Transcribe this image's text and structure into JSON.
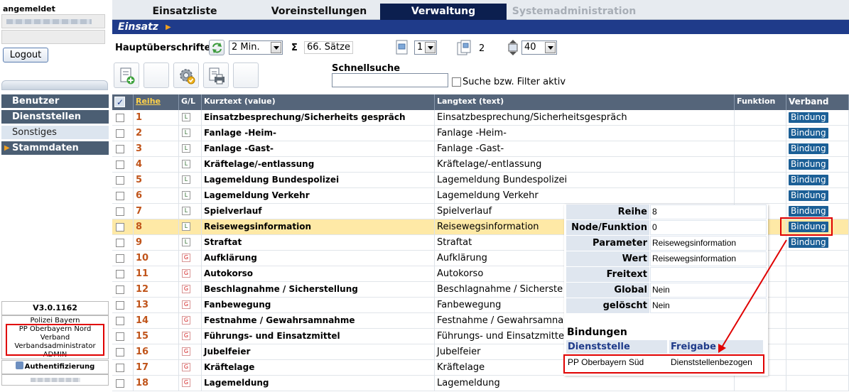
{
  "sidebar": {
    "login_label": "angemeldet",
    "logout_label": "Logout",
    "nav": [
      {
        "label": "Benutzer"
      },
      {
        "label": "Dienststellen"
      },
      {
        "label": "Sonstiges"
      },
      {
        "label": "Stammdaten"
      }
    ],
    "version": "V3.0.1162",
    "org_lines": [
      "Polizei Bayern",
      "PP Oberbayern Nord",
      "Verband",
      "Verbandsadministrator",
      "ADMIN"
    ],
    "auth_label": "Authentifizierung"
  },
  "tabs": [
    {
      "label": "Einsatzliste"
    },
    {
      "label": "Voreinstellungen"
    },
    {
      "label": "Verwaltung",
      "active": true
    },
    {
      "label": "Systemadministration",
      "disabled": true
    }
  ],
  "section_title": "Einsatz",
  "toolbar": {
    "headers_label": "Hauptüberschriften",
    "interval_value": "2 Min.",
    "sigma": "Σ",
    "record_count": "66. Sätze",
    "page_value": "1",
    "page_count": "2",
    "rows_value": "40"
  },
  "search": {
    "label": "Schnellsuche",
    "value": "",
    "filter_label": "Suche bzw. Filter aktiv"
  },
  "table": {
    "columns": [
      "Reihe",
      "G/L",
      "Kurztext (value)",
      "Langtext (text)",
      "Funktion",
      "Verband"
    ],
    "rows": [
      {
        "reihe": "1",
        "gl": "L",
        "kurz": "Einsatzbesprechung/Sicherheits gespräch",
        "lang": "Einsatzbesprechung/Sicherheitsgespräch",
        "bindung": "Bindung"
      },
      {
        "reihe": "2",
        "gl": "L",
        "kurz": "Fanlage -Heim-",
        "lang": "Fanlage -Heim-",
        "bindung": "Bindung"
      },
      {
        "reihe": "3",
        "gl": "L",
        "kurz": "Fanlage -Gast-",
        "lang": "Fanlage -Gast-",
        "bindung": "Bindung"
      },
      {
        "reihe": "4",
        "gl": "L",
        "kurz": "Kräftelage/-entlassung",
        "lang": "Kräftelage/-entlassung",
        "bindung": "Bindung"
      },
      {
        "reihe": "5",
        "gl": "L",
        "kurz": "Lagemeldung Bundespolizei",
        "lang": "Lagemeldung Bundespolizei",
        "bindung": "Bindung"
      },
      {
        "reihe": "6",
        "gl": "L",
        "kurz": "Lagemeldung Verkehr",
        "lang": "Lagemeldung Verkehr",
        "bindung": "Bindung"
      },
      {
        "reihe": "7",
        "gl": "L",
        "kurz": "Spielverlauf",
        "lang": "Spielverlauf",
        "bindung": "Bindung"
      },
      {
        "reihe": "8",
        "gl": "L",
        "kurz": "Reisewegsinformation",
        "lang": "Reisewegsinformation",
        "bindung": "Bindung",
        "selected": true
      },
      {
        "reihe": "9",
        "gl": "L",
        "kurz": "Straftat",
        "lang": "Straftat",
        "bindung": "Bindung"
      },
      {
        "reihe": "10",
        "gl": "G",
        "kurz": "Aufklärung",
        "lang": "Aufklärung",
        "bindung": ""
      },
      {
        "reihe": "11",
        "gl": "G",
        "kurz": "Autokorso",
        "lang": "Autokorso",
        "bindung": ""
      },
      {
        "reihe": "12",
        "gl": "G",
        "kurz": "Beschlagnahme / Sicherstellung",
        "lang": "Beschlagnahme / Sicherste",
        "bindung": ""
      },
      {
        "reihe": "13",
        "gl": "G",
        "kurz": "Fanbewegung",
        "lang": "Fanbewegung",
        "bindung": ""
      },
      {
        "reihe": "14",
        "gl": "G",
        "kurz": "Festnahme / Gewahrsamnahme",
        "lang": "Festnahme / Gewahrsamna",
        "bindung": ""
      },
      {
        "reihe": "15",
        "gl": "G",
        "kurz": "Führungs- und Einsatzmittel",
        "lang": "Führungs- und Einsatzmitte",
        "bindung": ""
      },
      {
        "reihe": "16",
        "gl": "G",
        "kurz": "Jubelfeier",
        "lang": "Jubelfeier",
        "bindung": ""
      },
      {
        "reihe": "17",
        "gl": "G",
        "kurz": "Kräftelage",
        "lang": "Kräftelage",
        "bindung": ""
      },
      {
        "reihe": "18",
        "gl": "G",
        "kurz": "Lagemeldung",
        "lang": "Lagemeldung",
        "bindung": ""
      }
    ]
  },
  "popup": {
    "fields": [
      {
        "key": "Reihe",
        "value": "8"
      },
      {
        "key": "Node/Funktion",
        "value": "0"
      },
      {
        "key": "Parameter",
        "value": "Reisewegsinformation"
      },
      {
        "key": "Wert",
        "value": "Reisewegsinformation"
      },
      {
        "key": "Freitext",
        "value": ""
      },
      {
        "key": "Global",
        "value": "Nein"
      },
      {
        "key": "gelöscht",
        "value": "Nein"
      }
    ],
    "bindings_title": "Bindungen",
    "bindings_headers": [
      "Dienststelle",
      "Freigabe"
    ],
    "bindings_rows": [
      {
        "dienststelle": "PP Oberbayern Süd",
        "freigabe": "Dienststellenbezogen"
      }
    ]
  },
  "colors": {
    "active_tab": "#0c1f4f",
    "section_bar": "#1f3b8a",
    "table_header": "#55657a",
    "bindung_button": "#1b5f96",
    "selected_row": "#fee9a6",
    "annotation_red": "#e00000"
  }
}
